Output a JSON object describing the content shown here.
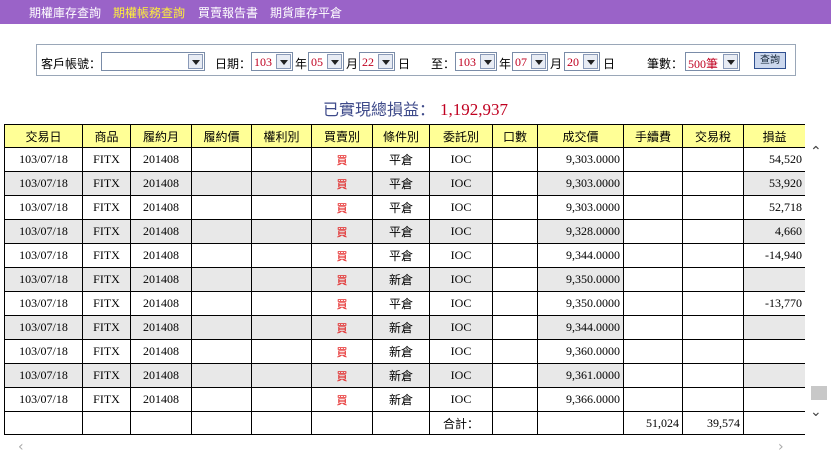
{
  "nav": {
    "items": [
      "期權庫存查詢",
      "期權帳務查詢",
      "買賣報告書",
      "期貨庫存平倉"
    ]
  },
  "filter": {
    "account_label": "客戶帳號：",
    "account_value": "",
    "date_label": "日期：",
    "from": {
      "year": "103",
      "month": "05",
      "day": "22"
    },
    "to_label": "至：",
    "to": {
      "year": "103",
      "month": "07",
      "day": "20"
    },
    "year_unit": "年",
    "month_unit": "月",
    "day_unit": "日",
    "count_label": "筆數：",
    "count_value": "500筆",
    "query_button": "查詢"
  },
  "summary": {
    "label": "已實現總損益：",
    "value": "1,192,937"
  },
  "table": {
    "headers": [
      "交易日",
      "商品",
      "履約月",
      "履約價",
      "權利別",
      "買賣別",
      "條件別",
      "委託別",
      "口數",
      "成交價",
      "手續費",
      "交易稅",
      "損益"
    ],
    "rows": [
      [
        "103/07/18",
        "FITX",
        "201408",
        "",
        "",
        "買",
        "平倉",
        "IOC",
        "",
        "9,303.0000",
        "",
        "",
        "54,520"
      ],
      [
        "103/07/18",
        "FITX",
        "201408",
        "",
        "",
        "買",
        "平倉",
        "IOC",
        "",
        "9,303.0000",
        "",
        "",
        "53,920"
      ],
      [
        "103/07/18",
        "FITX",
        "201408",
        "",
        "",
        "買",
        "平倉",
        "IOC",
        "",
        "9,303.0000",
        "",
        "",
        "52,718"
      ],
      [
        "103/07/18",
        "FITX",
        "201408",
        "",
        "",
        "買",
        "平倉",
        "IOC",
        "",
        "9,328.0000",
        "",
        "",
        "4,660"
      ],
      [
        "103/07/18",
        "FITX",
        "201408",
        "",
        "",
        "買",
        "平倉",
        "IOC",
        "",
        "9,344.0000",
        "",
        "",
        "-14,940"
      ],
      [
        "103/07/18",
        "FITX",
        "201408",
        "",
        "",
        "買",
        "新倉",
        "IOC",
        "",
        "9,350.0000",
        "",
        "",
        ""
      ],
      [
        "103/07/18",
        "FITX",
        "201408",
        "",
        "",
        "買",
        "平倉",
        "IOC",
        "",
        "9,350.0000",
        "",
        "",
        "-13,770"
      ],
      [
        "103/07/18",
        "FITX",
        "201408",
        "",
        "",
        "買",
        "新倉",
        "IOC",
        "",
        "9,344.0000",
        "",
        "",
        ""
      ],
      [
        "103/07/18",
        "FITX",
        "201408",
        "",
        "",
        "買",
        "新倉",
        "IOC",
        "",
        "9,360.0000",
        "",
        "",
        ""
      ],
      [
        "103/07/18",
        "FITX",
        "201408",
        "",
        "",
        "買",
        "新倉",
        "IOC",
        "",
        "9,361.0000",
        "",
        "",
        ""
      ],
      [
        "103/07/18",
        "FITX",
        "201408",
        "",
        "",
        "買",
        "新倉",
        "IOC",
        "",
        "9,366.0000",
        "",
        "",
        ""
      ]
    ],
    "footer": {
      "total_label": "合計：",
      "fee_total": "51,024",
      "tax_total": "39,574"
    }
  },
  "colors": {
    "nav_bg": "#9a63c8",
    "nav_active": "#ffef3a",
    "header_bg": "#ffff96",
    "accent_red": "#c00020",
    "summary_label": "#3e4a8a"
  }
}
